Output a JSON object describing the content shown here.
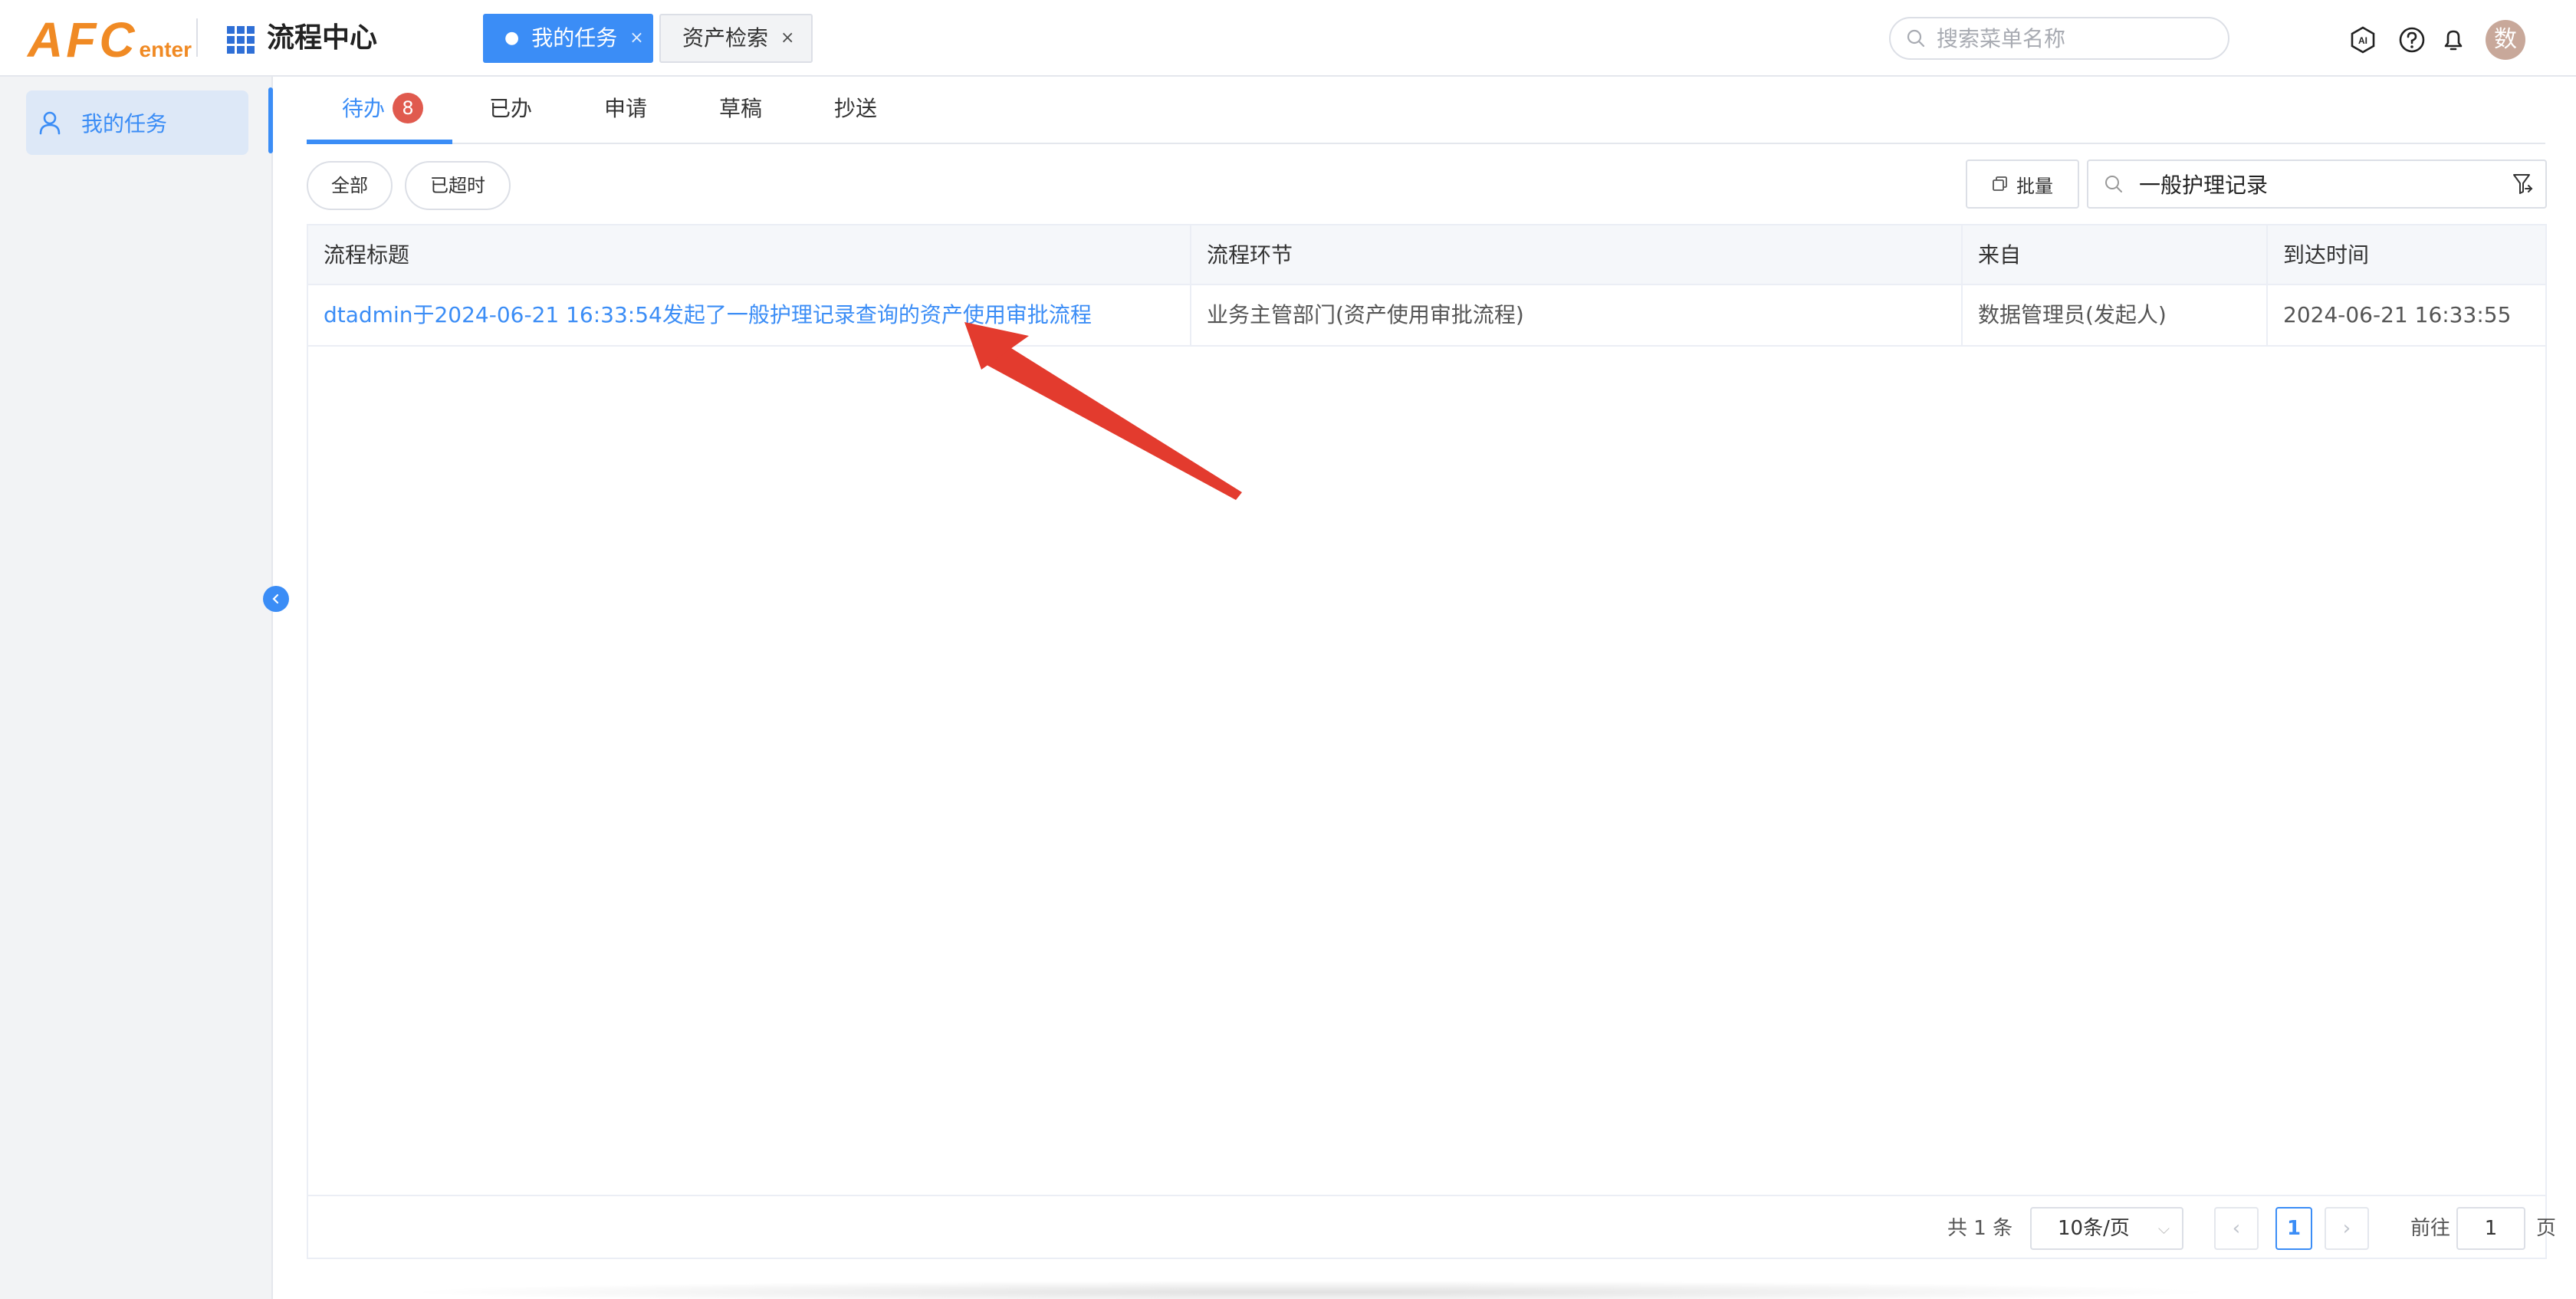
{
  "header": {
    "logo_big": "AFC",
    "logo_small": "enter",
    "app_title": "流程中心",
    "open_tabs": [
      {
        "label": "我的任务",
        "active": true
      },
      {
        "label": "资产检索",
        "active": false
      }
    ],
    "close_glyph": "×",
    "active_dot": "●",
    "search_placeholder": "搜索菜单名称",
    "icons": [
      "ai-icon",
      "help-icon",
      "bell-icon"
    ],
    "avatar_text": "数"
  },
  "sidebar": {
    "items": [
      {
        "label": "我的任务",
        "icon": "user-icon",
        "active": true
      }
    ]
  },
  "main": {
    "tabs": [
      {
        "label": "待办",
        "badge": "8",
        "active": true
      },
      {
        "label": "已办"
      },
      {
        "label": "申请"
      },
      {
        "label": "草稿"
      },
      {
        "label": "抄送"
      }
    ],
    "filters": {
      "all_label": "全部",
      "overdue_label": "已超时"
    },
    "batch_label": "批量",
    "search_value": "一般护理记录",
    "table": {
      "columns": [
        "流程标题",
        "流程环节",
        "来自",
        "到达时间"
      ],
      "rows": [
        {
          "title": "dtadmin于2024-06-21 16:33:54发起了一般护理记录查询的资产使用审批流程",
          "stage": "业务主管部门(资产使用审批流程)",
          "from": "数据管理员(发起人)",
          "arrival": "2024-06-21 16:33:55"
        }
      ]
    },
    "pagination": {
      "total_text": "共 1 条",
      "page_size": "10条/页",
      "current_page": "1",
      "goto_prefix": "前往",
      "goto_value": "1",
      "goto_suffix": "页"
    }
  },
  "colors": {
    "primary": "#3b8df6",
    "logo": "#f08a24",
    "badge": "#e05a4e",
    "annotation_arrow": "#e33b2e"
  }
}
